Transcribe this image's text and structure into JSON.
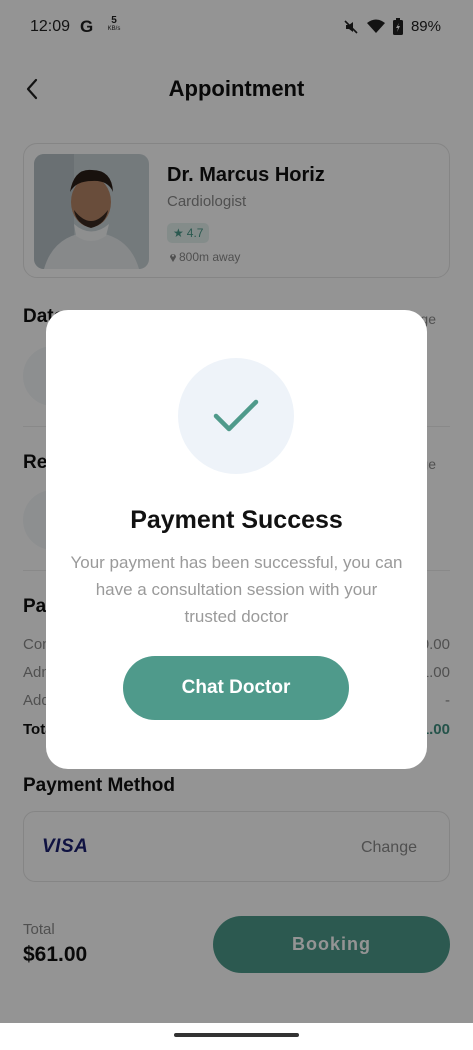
{
  "status_bar": {
    "time": "12:09",
    "g_label": "G",
    "net_speed": "5",
    "net_unit": "KB/s",
    "battery": "89%"
  },
  "header": {
    "title": "Appointment"
  },
  "doctor": {
    "name": "Dr. Marcus Horiz",
    "specialty": "Cardiologist",
    "rating": "4.7",
    "distance": "800m away"
  },
  "sections": {
    "date_title": "Date",
    "date_change": "Change",
    "reason_title": "Reason",
    "reason_change": "Change",
    "payment_detail_title": "Payment Detail"
  },
  "payment_rows": [
    {
      "label": "Consultation",
      "value": "$60.00"
    },
    {
      "label": "Admin Fee",
      "value": "$01.00"
    },
    {
      "label": "Additional Discount",
      "value": "-"
    },
    {
      "label": "Total",
      "value": "$61.00"
    }
  ],
  "payment_method": {
    "title": "Payment Method",
    "card_brand": "VISA",
    "change_label": "Change"
  },
  "footer": {
    "total_label": "Total",
    "total_value": "$61.00",
    "booking_label": "Booking"
  },
  "modal": {
    "title": "Payment Success",
    "message": "Your payment has been successful, you can have a consultation session with your trusted doctor",
    "button_label": "Chat Doctor"
  },
  "colors": {
    "accent": "#4f9a8b",
    "accent_light": "#e4f2ee",
    "overlay": "rgba(0,0,0,0.42)"
  }
}
